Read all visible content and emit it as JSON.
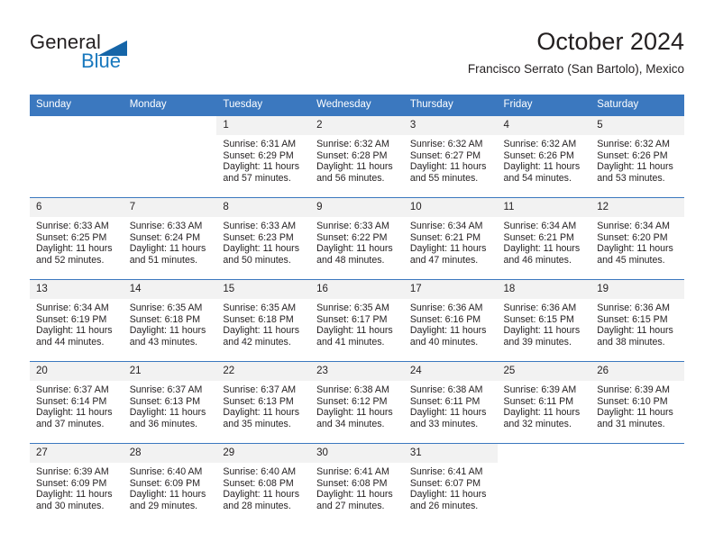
{
  "brand": {
    "name_top": "General",
    "name_bottom": "Blue",
    "triangle_color": "#1565a8",
    "blue_color": "#1878be"
  },
  "header": {
    "title": "October 2024",
    "subtitle": "Francisco Serrato (San Bartolo), Mexico"
  },
  "theme": {
    "header_bg": "#3b78bf",
    "daynum_bg": "#f2f2f2",
    "text": "#231f20",
    "page_bg": "#ffffff"
  },
  "calendar": {
    "weekday_headers": [
      "Sunday",
      "Monday",
      "Tuesday",
      "Wednesday",
      "Thursday",
      "Friday",
      "Saturday"
    ],
    "weeks": [
      [
        {
          "day": "",
          "sunrise": "",
          "sunset": "",
          "daylight1": "",
          "daylight2": ""
        },
        {
          "day": "",
          "sunrise": "",
          "sunset": "",
          "daylight1": "",
          "daylight2": ""
        },
        {
          "day": "1",
          "sunrise": "Sunrise: 6:31 AM",
          "sunset": "Sunset: 6:29 PM",
          "daylight1": "Daylight: 11 hours",
          "daylight2": "and 57 minutes."
        },
        {
          "day": "2",
          "sunrise": "Sunrise: 6:32 AM",
          "sunset": "Sunset: 6:28 PM",
          "daylight1": "Daylight: 11 hours",
          "daylight2": "and 56 minutes."
        },
        {
          "day": "3",
          "sunrise": "Sunrise: 6:32 AM",
          "sunset": "Sunset: 6:27 PM",
          "daylight1": "Daylight: 11 hours",
          "daylight2": "and 55 minutes."
        },
        {
          "day": "4",
          "sunrise": "Sunrise: 6:32 AM",
          "sunset": "Sunset: 6:26 PM",
          "daylight1": "Daylight: 11 hours",
          "daylight2": "and 54 minutes."
        },
        {
          "day": "5",
          "sunrise": "Sunrise: 6:32 AM",
          "sunset": "Sunset: 6:26 PM",
          "daylight1": "Daylight: 11 hours",
          "daylight2": "and 53 minutes."
        }
      ],
      [
        {
          "day": "6",
          "sunrise": "Sunrise: 6:33 AM",
          "sunset": "Sunset: 6:25 PM",
          "daylight1": "Daylight: 11 hours",
          "daylight2": "and 52 minutes."
        },
        {
          "day": "7",
          "sunrise": "Sunrise: 6:33 AM",
          "sunset": "Sunset: 6:24 PM",
          "daylight1": "Daylight: 11 hours",
          "daylight2": "and 51 minutes."
        },
        {
          "day": "8",
          "sunrise": "Sunrise: 6:33 AM",
          "sunset": "Sunset: 6:23 PM",
          "daylight1": "Daylight: 11 hours",
          "daylight2": "and 50 minutes."
        },
        {
          "day": "9",
          "sunrise": "Sunrise: 6:33 AM",
          "sunset": "Sunset: 6:22 PM",
          "daylight1": "Daylight: 11 hours",
          "daylight2": "and 48 minutes."
        },
        {
          "day": "10",
          "sunrise": "Sunrise: 6:34 AM",
          "sunset": "Sunset: 6:21 PM",
          "daylight1": "Daylight: 11 hours",
          "daylight2": "and 47 minutes."
        },
        {
          "day": "11",
          "sunrise": "Sunrise: 6:34 AM",
          "sunset": "Sunset: 6:21 PM",
          "daylight1": "Daylight: 11 hours",
          "daylight2": "and 46 minutes."
        },
        {
          "day": "12",
          "sunrise": "Sunrise: 6:34 AM",
          "sunset": "Sunset: 6:20 PM",
          "daylight1": "Daylight: 11 hours",
          "daylight2": "and 45 minutes."
        }
      ],
      [
        {
          "day": "13",
          "sunrise": "Sunrise: 6:34 AM",
          "sunset": "Sunset: 6:19 PM",
          "daylight1": "Daylight: 11 hours",
          "daylight2": "and 44 minutes."
        },
        {
          "day": "14",
          "sunrise": "Sunrise: 6:35 AM",
          "sunset": "Sunset: 6:18 PM",
          "daylight1": "Daylight: 11 hours",
          "daylight2": "and 43 minutes."
        },
        {
          "day": "15",
          "sunrise": "Sunrise: 6:35 AM",
          "sunset": "Sunset: 6:18 PM",
          "daylight1": "Daylight: 11 hours",
          "daylight2": "and 42 minutes."
        },
        {
          "day": "16",
          "sunrise": "Sunrise: 6:35 AM",
          "sunset": "Sunset: 6:17 PM",
          "daylight1": "Daylight: 11 hours",
          "daylight2": "and 41 minutes."
        },
        {
          "day": "17",
          "sunrise": "Sunrise: 6:36 AM",
          "sunset": "Sunset: 6:16 PM",
          "daylight1": "Daylight: 11 hours",
          "daylight2": "and 40 minutes."
        },
        {
          "day": "18",
          "sunrise": "Sunrise: 6:36 AM",
          "sunset": "Sunset: 6:15 PM",
          "daylight1": "Daylight: 11 hours",
          "daylight2": "and 39 minutes."
        },
        {
          "day": "19",
          "sunrise": "Sunrise: 6:36 AM",
          "sunset": "Sunset: 6:15 PM",
          "daylight1": "Daylight: 11 hours",
          "daylight2": "and 38 minutes."
        }
      ],
      [
        {
          "day": "20",
          "sunrise": "Sunrise: 6:37 AM",
          "sunset": "Sunset: 6:14 PM",
          "daylight1": "Daylight: 11 hours",
          "daylight2": "and 37 minutes."
        },
        {
          "day": "21",
          "sunrise": "Sunrise: 6:37 AM",
          "sunset": "Sunset: 6:13 PM",
          "daylight1": "Daylight: 11 hours",
          "daylight2": "and 36 minutes."
        },
        {
          "day": "22",
          "sunrise": "Sunrise: 6:37 AM",
          "sunset": "Sunset: 6:13 PM",
          "daylight1": "Daylight: 11 hours",
          "daylight2": "and 35 minutes."
        },
        {
          "day": "23",
          "sunrise": "Sunrise: 6:38 AM",
          "sunset": "Sunset: 6:12 PM",
          "daylight1": "Daylight: 11 hours",
          "daylight2": "and 34 minutes."
        },
        {
          "day": "24",
          "sunrise": "Sunrise: 6:38 AM",
          "sunset": "Sunset: 6:11 PM",
          "daylight1": "Daylight: 11 hours",
          "daylight2": "and 33 minutes."
        },
        {
          "day": "25",
          "sunrise": "Sunrise: 6:39 AM",
          "sunset": "Sunset: 6:11 PM",
          "daylight1": "Daylight: 11 hours",
          "daylight2": "and 32 minutes."
        },
        {
          "day": "26",
          "sunrise": "Sunrise: 6:39 AM",
          "sunset": "Sunset: 6:10 PM",
          "daylight1": "Daylight: 11 hours",
          "daylight2": "and 31 minutes."
        }
      ],
      [
        {
          "day": "27",
          "sunrise": "Sunrise: 6:39 AM",
          "sunset": "Sunset: 6:09 PM",
          "daylight1": "Daylight: 11 hours",
          "daylight2": "and 30 minutes."
        },
        {
          "day": "28",
          "sunrise": "Sunrise: 6:40 AM",
          "sunset": "Sunset: 6:09 PM",
          "daylight1": "Daylight: 11 hours",
          "daylight2": "and 29 minutes."
        },
        {
          "day": "29",
          "sunrise": "Sunrise: 6:40 AM",
          "sunset": "Sunset: 6:08 PM",
          "daylight1": "Daylight: 11 hours",
          "daylight2": "and 28 minutes."
        },
        {
          "day": "30",
          "sunrise": "Sunrise: 6:41 AM",
          "sunset": "Sunset: 6:08 PM",
          "daylight1": "Daylight: 11 hours",
          "daylight2": "and 27 minutes."
        },
        {
          "day": "31",
          "sunrise": "Sunrise: 6:41 AM",
          "sunset": "Sunset: 6:07 PM",
          "daylight1": "Daylight: 11 hours",
          "daylight2": "and 26 minutes."
        },
        {
          "day": "",
          "sunrise": "",
          "sunset": "",
          "daylight1": "",
          "daylight2": ""
        },
        {
          "day": "",
          "sunrise": "",
          "sunset": "",
          "daylight1": "",
          "daylight2": ""
        }
      ]
    ]
  }
}
